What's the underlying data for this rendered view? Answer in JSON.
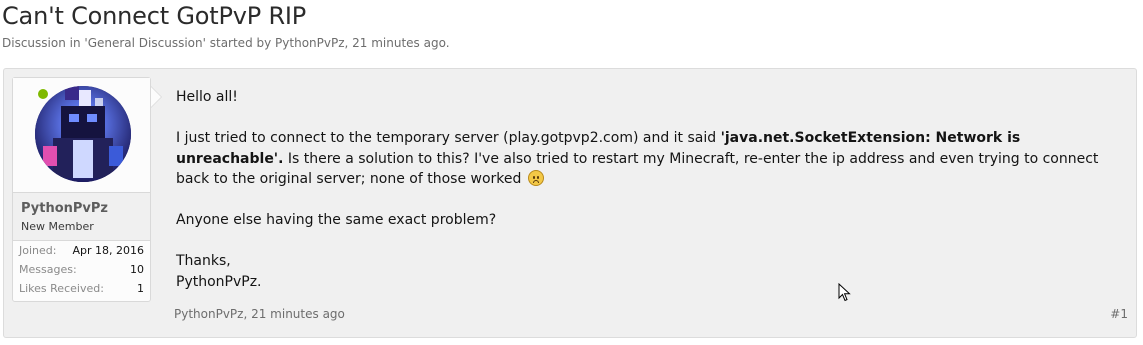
{
  "thread": {
    "title": "Can't Connect GotPvP RIP",
    "meta_prefix": "Discussion in ",
    "forum_link": "'General Discussion'",
    "meta_middle": " started by ",
    "author_link": "PythonPvPz",
    "meta_time": ", 21 minutes ago."
  },
  "post": {
    "author": {
      "username": "PythonPvPz",
      "title": "New Member",
      "online": true,
      "stats": [
        {
          "label": "Joined:",
          "value": "Apr 18, 2016"
        },
        {
          "label": "Messages:",
          "value": "10"
        },
        {
          "label": "Likes Received:",
          "value": "1"
        }
      ]
    },
    "body": {
      "greeting": "Hello all!",
      "p2_a": "I just tried to connect to the temporary server (play.gotpvp2.com) and it said ",
      "p2_bold": "'java.net.SocketExtension: Network is unreachable'.",
      "p2_b": " Is there a solution to this? I've also tried to restart my Minecraft, re-enter the ip address and even trying to connect back to the original server; none of those worked",
      "p3": "Anyone else having the same exact problem?",
      "signoff": "Thanks,",
      "signature": "PythonPvPz."
    },
    "footer": {
      "author": "PythonPvPz",
      "time": ", 21 minutes ago",
      "number": "#1"
    }
  },
  "colors": {
    "online": "#7fb900",
    "post_bg": "#f0f0f0",
    "avatar_bg": "#1e1f6e"
  }
}
